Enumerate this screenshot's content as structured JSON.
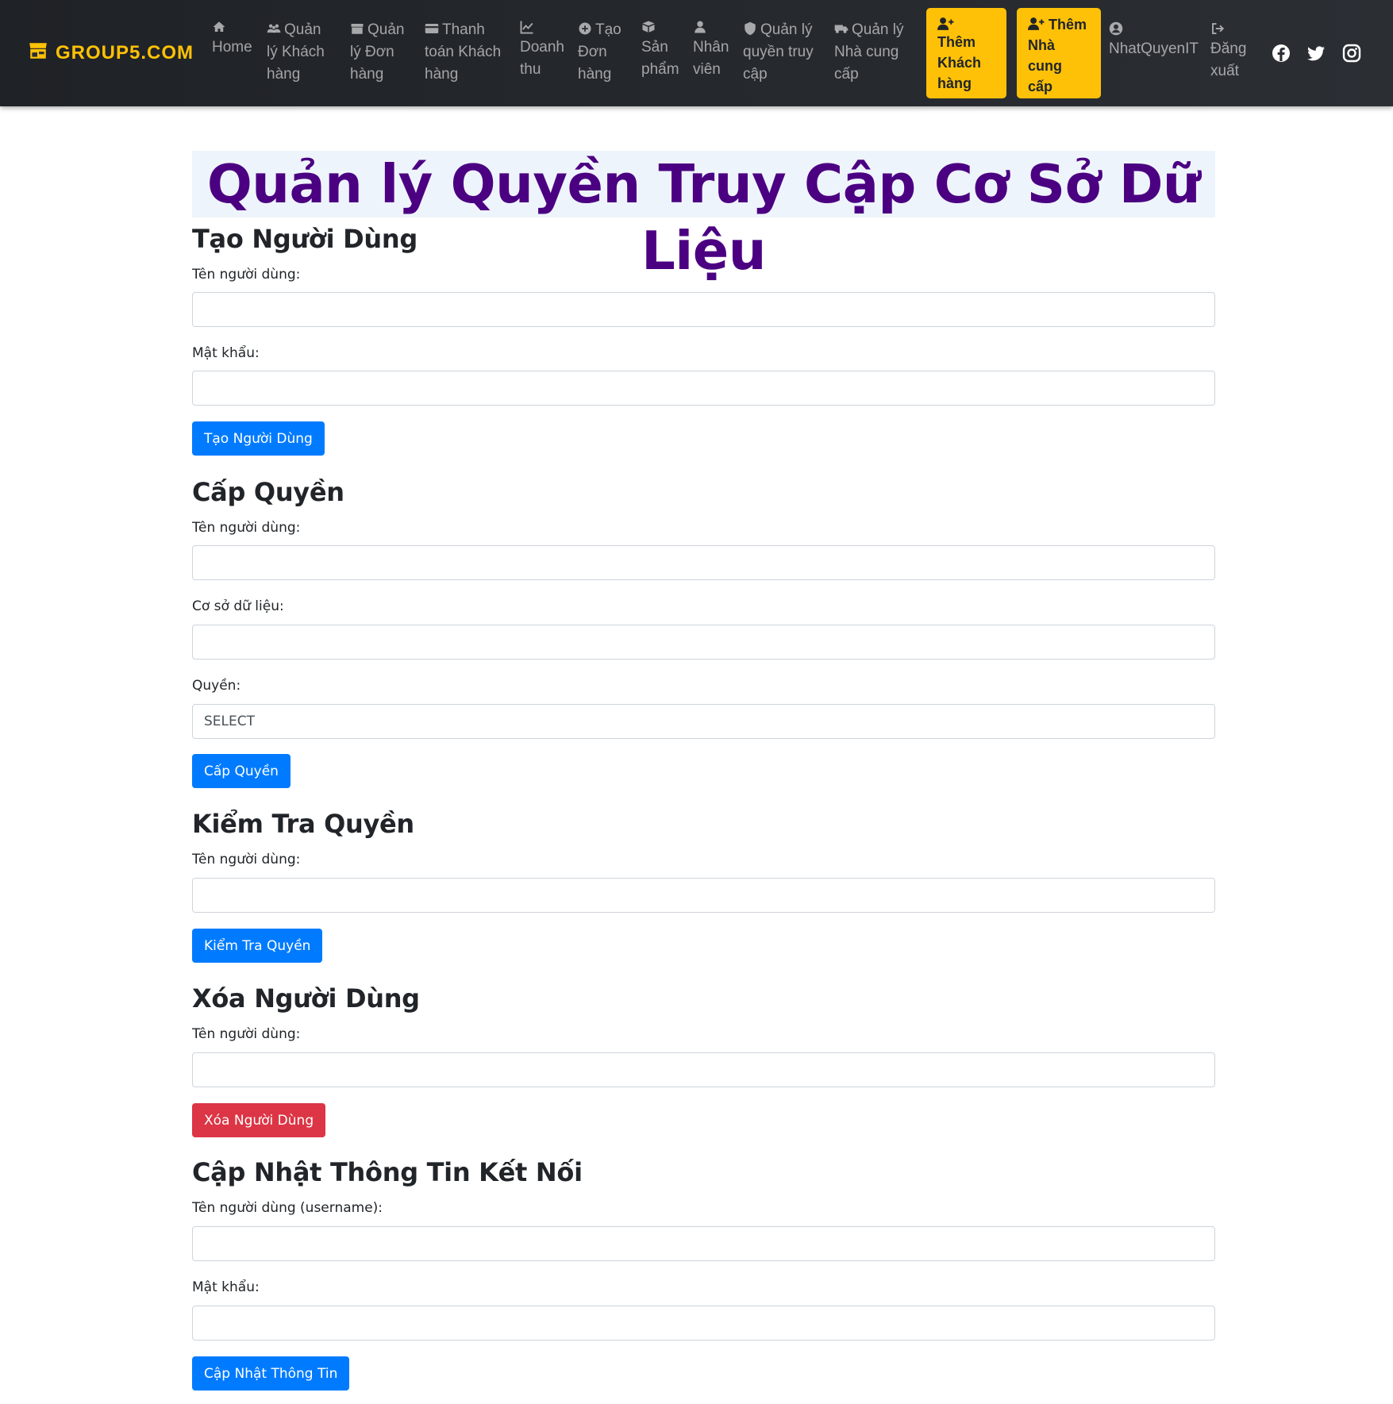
{
  "brand": {
    "name": "GROUP5.COM",
    "icon": "store-icon",
    "color": "#ffc107"
  },
  "nav": {
    "home": "Home",
    "customers_l1": "Quản",
    "customers_l2": "lý Khách",
    "customers_l3": "hàng",
    "orders_l1": "Quản",
    "orders_l2": "lý Đơn",
    "orders_l3": "hàng",
    "payment_l1": "Thanh",
    "payment_l2": "toán Khách",
    "payment_l3": "hàng",
    "revenue_l1": "Doanh",
    "revenue_l2": "thu",
    "create_order_l1": "Tạo",
    "create_order_l2": "Đơn",
    "create_order_l3": "hàng",
    "products_l1": "Sản",
    "products_l2": "phẩm",
    "staff_l1": "Nhân",
    "staff_l2": "viên",
    "access_l1": "Quản lý",
    "access_l2": "quyền truy",
    "access_l3": "cập",
    "suppliers_l1": "Quản lý",
    "suppliers_l2": "Nhà cung",
    "suppliers_l3": "cấp",
    "add_customer_l1": "Thêm",
    "add_customer_l2": "Khách",
    "add_customer_l3": "hàng",
    "add_supplier_l1": "Thêm",
    "add_supplier_l2": "Nhà",
    "add_supplier_l3": "cung cấp",
    "user": "NhatQuyenIT",
    "logout_l1": "Đăng",
    "logout_l2": "xuất"
  },
  "page": {
    "title": "Quản lý Quyền Truy Cập Cơ Sở Dữ Liệu"
  },
  "create_user": {
    "heading": "Tạo Người Dùng",
    "username_label": "Tên người dùng:",
    "username_value": "",
    "password_label": "Mật khẩu:",
    "password_value": "",
    "button": "Tạo Người Dùng"
  },
  "grant": {
    "heading": "Cấp Quyền",
    "username_label": "Tên người dùng:",
    "username_value": "",
    "database_label": "Cơ sở dữ liệu:",
    "database_value": "",
    "privilege_label": "Quyền:",
    "privilege_selected": "SELECT",
    "button": "Cấp Quyền"
  },
  "check": {
    "heading": "Kiểm Tra Quyền",
    "username_label": "Tên người dùng:",
    "username_value": "",
    "button": "Kiểm Tra Quyền"
  },
  "delete_user": {
    "heading": "Xóa Người Dùng",
    "username_label": "Tên người dùng:",
    "username_value": "",
    "button": "Xóa Người Dùng"
  },
  "update_conn": {
    "heading": "Cập Nhật Thông Tin Kết Nối",
    "username_label": "Tên người dùng (username):",
    "username_value": "",
    "password_label": "Mật khẩu:",
    "password_value": "",
    "button": "Cập Nhật Thông Tin"
  },
  "colors": {
    "title": "#4b0082",
    "primary": "#007bff",
    "danger": "#dc3545",
    "highlight": "#ffc107",
    "navbar": "#2b2f34"
  },
  "social": [
    "facebook-icon",
    "twitter-icon",
    "instagram-icon"
  ]
}
